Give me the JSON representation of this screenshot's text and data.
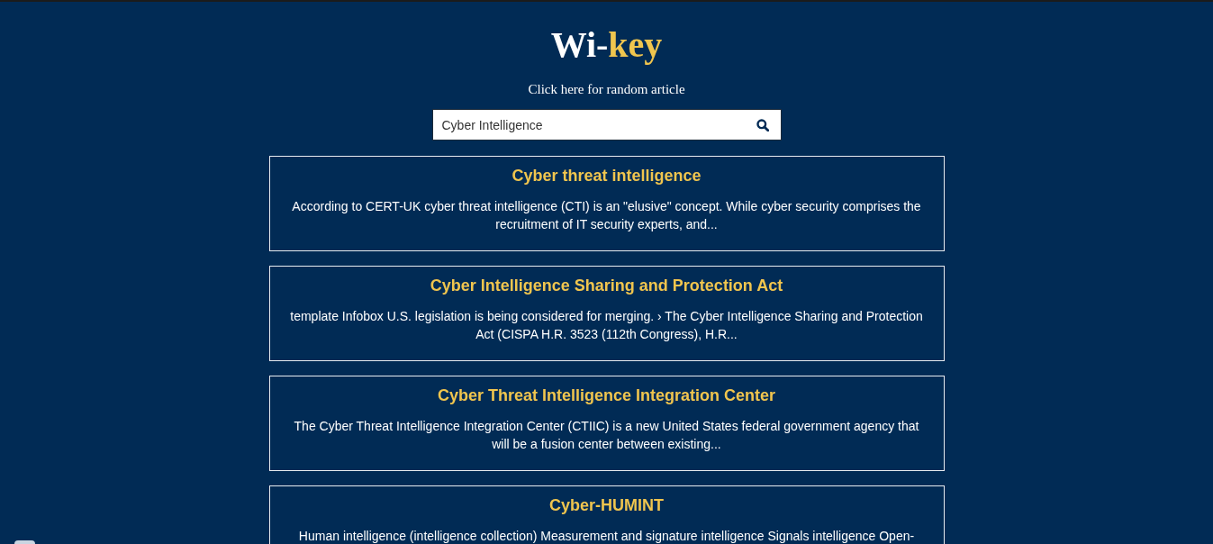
{
  "header": {
    "logo": [
      {
        "text": "Wi-",
        "color": "#ffffff"
      },
      {
        "text": "key",
        "color": "#f0c54e"
      }
    ],
    "random_link": "Click here for random article"
  },
  "search": {
    "value": "Cyber Intelligence"
  },
  "results": [
    {
      "title": "Cyber threat intelligence",
      "snippet": "According to CERT-UK cyber threat intelligence (CTI) is an \"elusive\" concept. While cyber security comprises the recruitment of IT security experts, and..."
    },
    {
      "title": "Cyber Intelligence Sharing and Protection Act",
      "snippet": "template Infobox U.S. legislation is being considered for merging. › The Cyber Intelligence Sharing and Protection Act (CISPA H.R. 3523 (112th Congress), H.R..."
    },
    {
      "title": "Cyber Threat Intelligence Integration Center",
      "snippet": "The Cyber Threat Intelligence Integration Center (CTIIC) is a new United States federal government agency that will be a fusion center between existing..."
    },
    {
      "title": "Cyber-HUMINT",
      "snippet": "Human intelligence (intelligence collection) Measurement and signature intelligence Signals intelligence Open-"
    }
  ]
}
